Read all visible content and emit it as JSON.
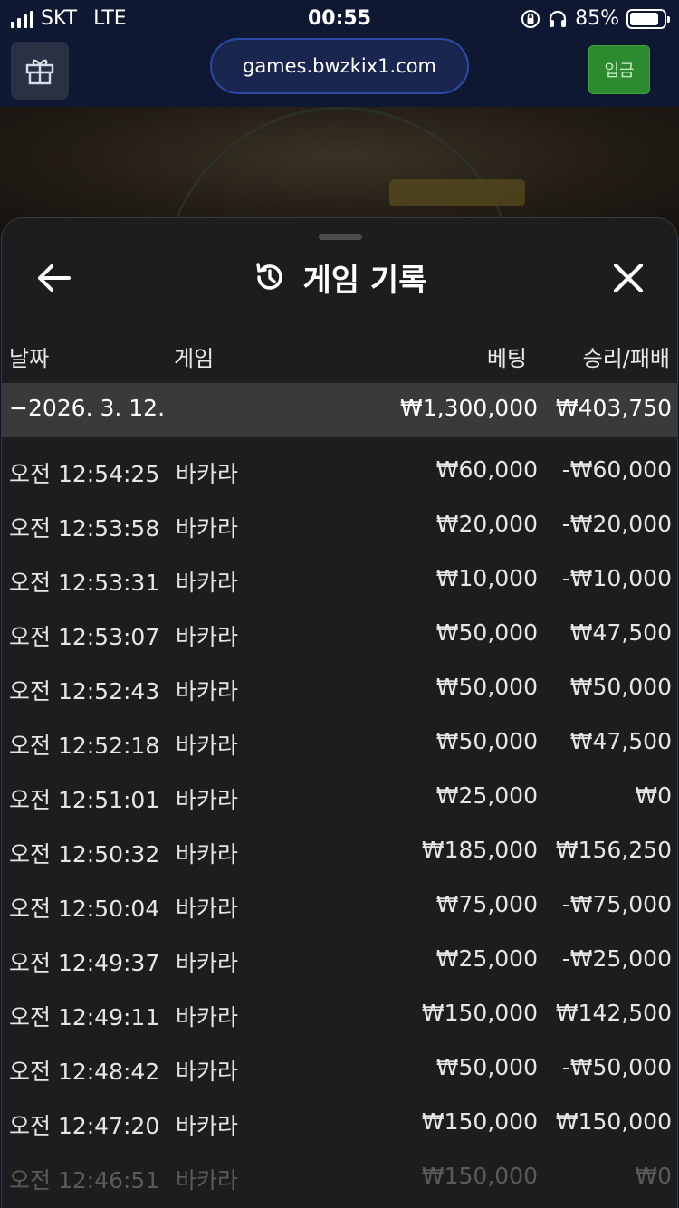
{
  "status": {
    "carrier": "SKT",
    "network": "LTE",
    "time": "00:55",
    "battery": "85%",
    "battery_level": 0.85
  },
  "browser": {
    "url": "games.bwzkix1.com",
    "deposit_label": "입금"
  },
  "sheet": {
    "title": "게임 기록",
    "columns": {
      "date": "날짜",
      "game": "게임",
      "bet": "베팅",
      "result": "승리/패배"
    },
    "summary": {
      "date": "−2026. 3. 12.",
      "bet": "₩1,300,000",
      "result": "₩403,750"
    },
    "rows": [
      {
        "time": "오전 12:54:25",
        "game": "바카라",
        "bet": "₩60,000",
        "result": "-₩60,000"
      },
      {
        "time": "오전 12:53:58",
        "game": "바카라",
        "bet": "₩20,000",
        "result": "-₩20,000"
      },
      {
        "time": "오전 12:53:31",
        "game": "바카라",
        "bet": "₩10,000",
        "result": "-₩10,000"
      },
      {
        "time": "오전 12:53:07",
        "game": "바카라",
        "bet": "₩50,000",
        "result": "₩47,500"
      },
      {
        "time": "오전 12:52:43",
        "game": "바카라",
        "bet": "₩50,000",
        "result": "₩50,000"
      },
      {
        "time": "오전 12:52:18",
        "game": "바카라",
        "bet": "₩50,000",
        "result": "₩47,500"
      },
      {
        "time": "오전 12:51:01",
        "game": "바카라",
        "bet": "₩25,000",
        "result": "₩0"
      },
      {
        "time": "오전 12:50:32",
        "game": "바카라",
        "bet": "₩185,000",
        "result": "₩156,250"
      },
      {
        "time": "오전 12:50:04",
        "game": "바카라",
        "bet": "₩75,000",
        "result": "-₩75,000"
      },
      {
        "time": "오전 12:49:37",
        "game": "바카라",
        "bet": "₩25,000",
        "result": "-₩25,000"
      },
      {
        "time": "오전 12:49:11",
        "game": "바카라",
        "bet": "₩150,000",
        "result": "₩142,500"
      },
      {
        "time": "오전 12:48:42",
        "game": "바카라",
        "bet": "₩50,000",
        "result": "-₩50,000"
      },
      {
        "time": "오전 12:47:20",
        "game": "바카라",
        "bet": "₩150,000",
        "result": "₩150,000"
      },
      {
        "time": "오전 12:46:51",
        "game": "바카라",
        "bet": "₩150,000",
        "result": "₩0"
      }
    ]
  },
  "icons": {
    "signal": "signal-icon",
    "rotation_lock": "rotation-lock-icon",
    "headphones": "headphones-icon",
    "battery": "battery-icon",
    "gift": "gift-icon",
    "back": "back-arrow-icon",
    "history": "history-icon",
    "close": "close-icon"
  },
  "colors": {
    "deposit_button": "#2d8a2f",
    "sheet_background": "#1d1d1e",
    "summary_row": "#3a3a3c"
  }
}
